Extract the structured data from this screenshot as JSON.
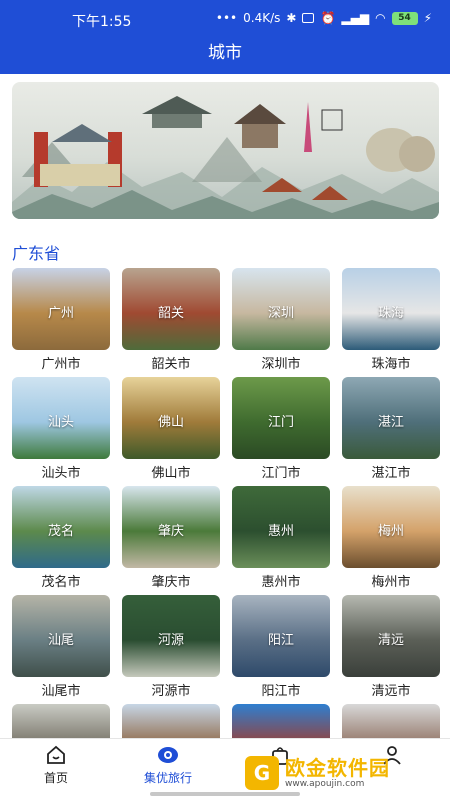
{
  "status_bar": {
    "time": "下午1:55",
    "network_speed": "0.4K/s",
    "battery": "54"
  },
  "header": {
    "title": "城市"
  },
  "section": {
    "title": "广东省"
  },
  "cities": [
    {
      "label": "广州市",
      "thumb_text": "广州",
      "colors": [
        "#c7d2e6",
        "#b7894a",
        "#8c6a3c"
      ]
    },
    {
      "label": "韶关市",
      "thumb_text": "韶关",
      "colors": [
        "#b8a48f",
        "#a04a32",
        "#4e6b3a"
      ]
    },
    {
      "label": "深圳市",
      "thumb_text": "深圳",
      "colors": [
        "#d7e4ee",
        "#c7b8a0",
        "#4f7a49"
      ]
    },
    {
      "label": "珠海市",
      "thumb_text": "珠海",
      "colors": [
        "#b8d0e6",
        "#e6e6e6",
        "#2d5b78"
      ]
    },
    {
      "label": "汕头市",
      "thumb_text": "汕头",
      "colors": [
        "#cfe3f1",
        "#9ec7e2",
        "#3e7a3c"
      ]
    },
    {
      "label": "佛山市",
      "thumb_text": "佛山",
      "colors": [
        "#e7d39a",
        "#a07b3a",
        "#3e5a2a"
      ]
    },
    {
      "label": "江门市",
      "thumb_text": "江门",
      "colors": [
        "#6d9a4a",
        "#3f6b2f",
        "#2b4a24"
      ]
    },
    {
      "label": "湛江市",
      "thumb_text": "湛江",
      "colors": [
        "#8ea8b4",
        "#4f6f7a",
        "#3a5a3a"
      ]
    },
    {
      "label": "茂名市",
      "thumb_text": "茂名",
      "colors": [
        "#bfd8e6",
        "#5d8a4c",
        "#2f6a8a"
      ]
    },
    {
      "label": "肇庆市",
      "thumb_text": "肇庆",
      "colors": [
        "#d8e6ee",
        "#4b7a3a",
        "#c2b8a5"
      ]
    },
    {
      "label": "惠州市",
      "thumb_text": "惠州",
      "colors": [
        "#3f6a3a",
        "#2c4f2f",
        "#6b8f5a"
      ]
    },
    {
      "label": "梅州市",
      "thumb_text": "梅州",
      "colors": [
        "#e8e0cc",
        "#d4a26a",
        "#6b4e2e"
      ]
    },
    {
      "label": "汕尾市",
      "thumb_text": "汕尾",
      "colors": [
        "#b5b4a7",
        "#6a7f84",
        "#3f4f4a"
      ]
    },
    {
      "label": "河源市",
      "thumb_text": "河源",
      "colors": [
        "#355f3a",
        "#2a4d31",
        "#c5c9bc"
      ]
    },
    {
      "label": "阳江市",
      "thumb_text": "阳江",
      "colors": [
        "#a8b4c0",
        "#5a6f86",
        "#2e4a6a"
      ]
    },
    {
      "label": "清远市",
      "thumb_text": "清远",
      "colors": [
        "#b6b9b1",
        "#5b5f57",
        "#3a3f3a"
      ]
    },
    {
      "label": "",
      "thumb_text": "",
      "colors": [
        "#c9cbc4",
        "#6e6a5e",
        "#3d3a34"
      ]
    },
    {
      "label": "",
      "thumb_text": "",
      "colors": [
        "#c7d6e6",
        "#8a5f3a",
        "#5a3a2a"
      ]
    },
    {
      "label": "",
      "thumb_text": "",
      "colors": [
        "#2f7fd0",
        "#a03a2a",
        "#e0c090"
      ]
    },
    {
      "label": "",
      "thumb_text": "",
      "colors": [
        "#d8d8d8",
        "#8a6a5a",
        "#5a4a40"
      ]
    }
  ],
  "tabbar": {
    "tabs": [
      {
        "label": "首页",
        "icon": "home-icon",
        "active": false
      },
      {
        "label": "集优旅行",
        "icon": "eye-icon",
        "active": true
      },
      {
        "label": "",
        "icon": "bag-icon",
        "active": false
      },
      {
        "label": "",
        "icon": "user-icon",
        "active": false
      }
    ]
  },
  "watermark": {
    "logo": "G",
    "title": "欧金软件园",
    "url": "www.apoujin.com"
  },
  "accent_color": "#1f4ed6"
}
